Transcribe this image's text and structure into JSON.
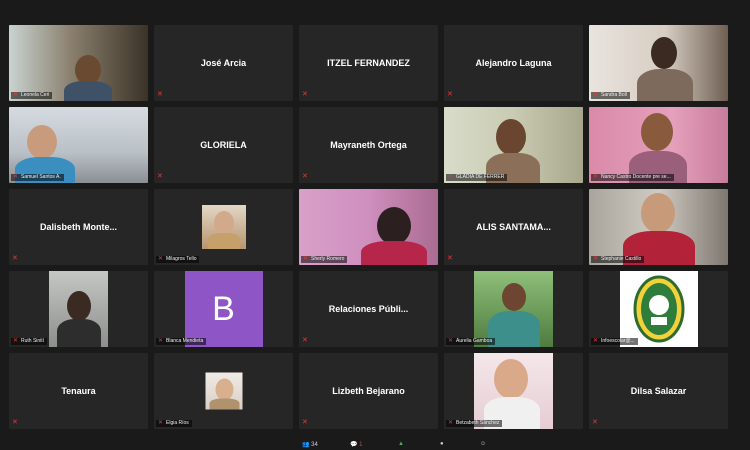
{
  "participants": [
    {
      "name": "Leonela Ceri",
      "video": true
    },
    {
      "name": "José Arcia",
      "video": false
    },
    {
      "name": "ITZEL FERNANDEZ",
      "video": false
    },
    {
      "name": "Alejandro Laguna",
      "video": false
    },
    {
      "name": "Sandra Bolí",
      "video": true
    },
    {
      "name": "Samuel Santos A.",
      "video": true
    },
    {
      "name": "GLORIELA",
      "video": false
    },
    {
      "name": "Mayraneth Ortega",
      "video": false
    },
    {
      "name": "GLADIA DE FERRER",
      "video": true,
      "speaking": true
    },
    {
      "name": "Nancy Castro Docente pre se...",
      "video": true
    },
    {
      "name": "Dalisbeth Monte...",
      "video": false
    },
    {
      "name": "Milagros Tello",
      "video": false,
      "avatar": "photo"
    },
    {
      "name": "Sherly Romero",
      "video": true
    },
    {
      "name": "ALIS SANTAMA...",
      "video": false
    },
    {
      "name": "Stephanie Castillo",
      "video": true
    },
    {
      "name": "Ruth Sinití",
      "video": true
    },
    {
      "name": "Blanca Mendieta",
      "video": false,
      "avatar": "letter",
      "letter": "B"
    },
    {
      "name": "Relaciones Públi...",
      "video": false
    },
    {
      "name": "Aurelia Gamboa",
      "video": false,
      "avatar": "photo"
    },
    {
      "name": "Infoescolar@...",
      "video": false,
      "avatar": "logo"
    },
    {
      "name": "Tenaura",
      "video": false
    },
    {
      "name": "Elgia Ríos",
      "video": false,
      "avatar": "photo"
    },
    {
      "name": "Lizbeth Bejarano",
      "video": false
    },
    {
      "name": "Betzabeth Sánchez",
      "video": false,
      "avatar": "photo"
    },
    {
      "name": "Dilsa Salazar",
      "video": false
    }
  ],
  "toolbar": {
    "participants_count": "34",
    "chat_badge": "1"
  },
  "colors": {
    "background": "#1a1a1a",
    "tile": "#262626",
    "speaking_border": "#b8d645",
    "muted": "#e23b3b",
    "avatar_letter_bg": "#8d55c6"
  }
}
